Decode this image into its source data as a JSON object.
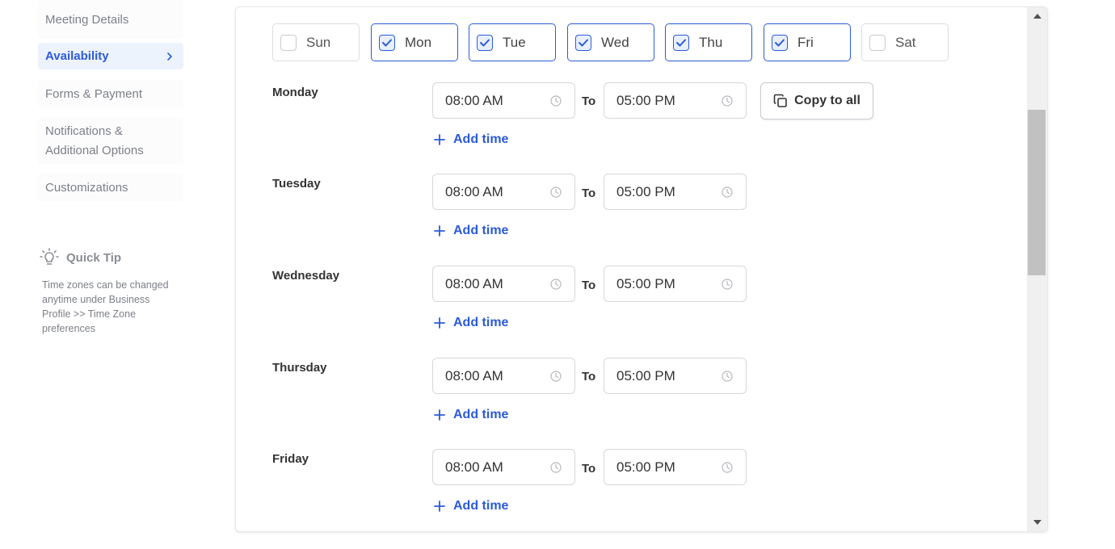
{
  "sidebar": {
    "items": [
      {
        "label": "Meeting Details",
        "active": false
      },
      {
        "label": "Availability",
        "active": true
      },
      {
        "label": "Forms & Payment",
        "active": false
      },
      {
        "label_line1": "Notifications &",
        "label_line2": "Additional Options",
        "active": false
      },
      {
        "label": "Customizations",
        "active": false
      }
    ],
    "tip": {
      "title": "Quick Tip",
      "text": "Time zones can be changed anytime under Business Profile >> Time Zone preferences",
      "icon": "lightbulb-icon"
    }
  },
  "days": [
    {
      "label": "Sun",
      "checked": false
    },
    {
      "label": "Mon",
      "checked": true
    },
    {
      "label": "Tue",
      "checked": true
    },
    {
      "label": "Wed",
      "checked": true
    },
    {
      "label": "Thu",
      "checked": true
    },
    {
      "label": "Fri",
      "checked": true
    },
    {
      "label": "Sat",
      "checked": false
    }
  ],
  "schedule": [
    {
      "day": "Monday",
      "start": "08:00 AM",
      "to": "To",
      "end": "05:00 PM",
      "add": "Add time"
    },
    {
      "day": "Tuesday",
      "start": "08:00 AM",
      "to": "To",
      "end": "05:00 PM",
      "add": "Add time"
    },
    {
      "day": "Wednesday",
      "start": "08:00 AM",
      "to": "To",
      "end": "05:00 PM",
      "add": "Add time"
    },
    {
      "day": "Thursday",
      "start": "08:00 AM",
      "to": "To",
      "end": "05:00 PM",
      "add": "Add time"
    },
    {
      "day": "Friday",
      "start": "08:00 AM",
      "to": "To",
      "end": "05:00 PM",
      "add": "Add time"
    }
  ],
  "copy_to_all": "Copy to all",
  "colors": {
    "accent": "#2b5bd8",
    "active_bg": "#edf3fd",
    "muted_text": "#7d8088"
  }
}
